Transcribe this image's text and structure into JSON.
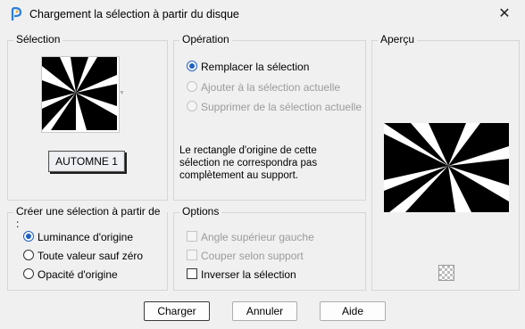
{
  "window": {
    "title": "Chargement la sélection à partir du disque",
    "close_glyph": "✕"
  },
  "selection_group": {
    "label": "Sélection",
    "selected_name": "AUTOMNE 1",
    "thumbnail_icon": "starburst-selection-thumbnail"
  },
  "operation_group": {
    "label": "Opération",
    "options": [
      {
        "label": "Remplacer la sélection",
        "checked": true,
        "disabled": false
      },
      {
        "label": "Ajouter à la sélection actuelle",
        "checked": false,
        "disabled": true
      },
      {
        "label": "Supprimer de la sélection actuelle",
        "checked": false,
        "disabled": true
      }
    ],
    "info": "Le rectangle d'origine de cette\nsélection ne correspondra pas\ncomplètement au support."
  },
  "preview_group": {
    "label": "Aperçu",
    "transparency_icon": "checkerboard-icon"
  },
  "create_group": {
    "label": "Créer une sélection à partir de :",
    "options": [
      {
        "label": "Luminance d'origine",
        "checked": true
      },
      {
        "label": "Toute valeur sauf zéro",
        "checked": false
      },
      {
        "label": "Opacité d'origine",
        "checked": false
      }
    ]
  },
  "options_group": {
    "label": "Options",
    "checkboxes": [
      {
        "label": "Angle supérieur gauche",
        "checked": false,
        "disabled": true
      },
      {
        "label": "Couper selon support",
        "checked": false,
        "disabled": true
      },
      {
        "label": "Inverser la sélection",
        "checked": false,
        "disabled": false
      }
    ]
  },
  "buttons": {
    "load": "Charger",
    "cancel": "Annuler",
    "help": "Aide"
  }
}
